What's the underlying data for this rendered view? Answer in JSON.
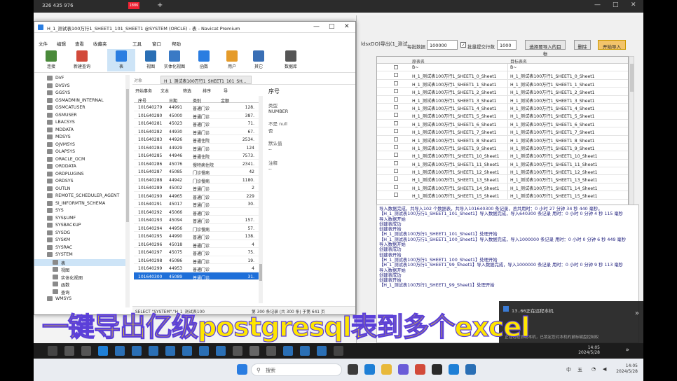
{
  "outer_bar": {
    "ip": "326 435 976",
    "tab": "1886",
    "plus": "+",
    "controls": [
      "—",
      "□",
      "✕"
    ]
  },
  "datasync": {
    "title": "ldsxDO)导出(1_测试",
    "labels": {
      "batch": "每批数据",
      "batch_value": "100000",
      "commit_label": "批量提交行数",
      "commit_value": "1000",
      "check": "✓"
    },
    "buttons": {
      "select": "选择要导入的目标",
      "delete": "删除",
      "start": "开始导入"
    },
    "grid_headers": {
      "src": "原表名",
      "dst": "目标表名"
    },
    "grid_rows": [
      {
        "src": "B~",
        "dst": "B~"
      },
      {
        "src": "H_1_测试表100万行1_SHEET1_0_Sheet1",
        "dst": "H_1_测试表100万行1_SHEET1_0_Sheet1"
      },
      {
        "src": "H_1_测试表100万行1_SHEET1_1_Sheet1",
        "dst": "H_1_测试表100万行1_SHEET1_1_Sheet1"
      },
      {
        "src": "H_1_测试表100万行1_SHEET1_2_Sheet1",
        "dst": "H_1_测试表100万行1_SHEET1_2_Sheet1"
      },
      {
        "src": "H_1_测试表100万行1_SHEET1_3_Sheet1",
        "dst": "H_1_测试表100万行1_SHEET1_3_Sheet1"
      },
      {
        "src": "H_1_测试表100万行1_SHEET1_4_Sheet1",
        "dst": "H_1_测试表100万行1_SHEET1_4_Sheet1"
      },
      {
        "src": "H_1_测试表100万行1_SHEET1_5_Sheet1",
        "dst": "H_1_测试表100万行1_SHEET1_5_Sheet1"
      },
      {
        "src": "H_1_测试表100万行1_SHEET1_6_Sheet1",
        "dst": "H_1_测试表100万行1_SHEET1_6_Sheet1"
      },
      {
        "src": "H_1_测试表100万行1_SHEET1_7_Sheet1",
        "dst": "H_1_测试表100万行1_SHEET1_7_Sheet1"
      },
      {
        "src": "H_1_测试表100万行1_SHEET1_8_Sheet1",
        "dst": "H_1_测试表100万行1_SHEET1_8_Sheet1"
      },
      {
        "src": "H_1_测试表100万行1_SHEET1_9_Sheet1",
        "dst": "H_1_测试表100万行1_SHEET1_9_Sheet1"
      },
      {
        "src": "H_1_测试表100万行1_SHEET1_10_Sheet1",
        "dst": "H_1_测试表100万行1_SHEET1_10_Sheet1"
      },
      {
        "src": "H_1_测试表100万行1_SHEET1_11_Sheet1",
        "dst": "H_1_测试表100万行1_SHEET1_11_Sheet1"
      },
      {
        "src": "H_1_测试表100万行1_SHEET1_12_Sheet1",
        "dst": "H_1_测试表100万行1_SHEET1_12_Sheet1"
      },
      {
        "src": "H_1_测试表100万行1_SHEET1_13_Sheet1",
        "dst": "H_1_测试表100万行1_SHEET1_13_Sheet1"
      },
      {
        "src": "H_1_测试表100万行1_SHEET1_14_Sheet1",
        "dst": "H_1_测试表100万行1_SHEET1_14_Sheet1"
      },
      {
        "src": "H_1_测试表100万行1_SHEET1_15_Sheet1",
        "dst": "H_1_测试表100万行1_SHEET1_15_Sheet1"
      }
    ],
    "log_lines": [
      "导入数据完成，共导入102 个数据表，共导入101640300 条记录，总共用时：0 小时 27 分钟 34 秒 440 毫秒。",
      "【H_1_测试表100万行1_SHEET1_101_Sheet1】导入数据完成，导入640300 条记录 用时：0 小时 0 分钟 4 秒 115 毫秒",
      "  导入数据开始",
      "  创建表成功",
      "  创建表开始",
      "【H_1_测试表100万行1_SHEET1_101_Sheet1】处理开始",
      "【H_1_测试表100万行1_SHEET1_100_Sheet1】导入数据完成，导入1000000 条记录 用时：0 小时 0 分钟 6 秒 449 毫秒",
      "  导入数据开始",
      "  创建表成功",
      "  创建表开始",
      "【H_1_测试表100万行1_SHEET1_100_Sheet1】处理开始",
      "【H_1_测试表100万行1_SHEET1_99_Sheet1】导入数据完成，导入1000000 条记录 用时：0 小时 0 分钟 9 秒 113 毫秒",
      "  导入数据开始",
      "  创建表成功",
      "  创建表开始",
      "【H_1_测试表100万行1_SHEET1_99_Sheet1】处理开始"
    ]
  },
  "navicat": {
    "title": "H_1_测试表100万行1_SHEET1_101_SHEET1 @SYSTEM (ORCLE) - 表 - Navicat Premium",
    "menu": [
      "文件",
      "编辑",
      "查看",
      "收藏夹",
      "工具",
      "窗口",
      "帮助"
    ],
    "ribbon": [
      {
        "label": "连接",
        "color": "#4a8a3a"
      },
      {
        "label": "新建查询",
        "color": "#d24a3a"
      },
      {
        "label": "表",
        "color": "#2a7de1"
      },
      {
        "label": "视图",
        "color": "#2a6fb5"
      },
      {
        "label": "实体化视图",
        "color": "#3a7ac5"
      },
      {
        "label": "函数",
        "color": "#2a7de1"
      },
      {
        "label": "用户",
        "color": "#e59b2a"
      },
      {
        "label": "其它",
        "color": "#3a6fb5"
      },
      {
        "label": "数据库",
        "color": "#555"
      }
    ],
    "tree": [
      "DVF",
      "DVSYS",
      "GGSYS",
      "GSMADMIN_INTERNAL",
      "GSMCATUSER",
      "GSMUSER",
      "LBACSYS",
      "MDDATA",
      "MDSYS",
      "OJVMSYS",
      "OLAPSYS",
      "ORACLE_OCM",
      "ORDDATA",
      "ORDPLUGINS",
      "ORDSYS",
      "OUTLN",
      "REMOTE_SCHEDULER_AGENT",
      "SI_INFORMTN_SCHEMA",
      "SYS",
      "SYS$UMF",
      "SYSBACKUP",
      "SYSDG",
      "SYSKM",
      "SYSRAC",
      "SYSTEM",
      "表",
      "视图",
      "实体化视图",
      "函数",
      "查询",
      "WMSYS"
    ],
    "obj_tab": {
      "objects": "对象",
      "table": "H_1_测试表100万行1_SHEET1_101_SH..."
    },
    "tools": [
      "开始事务",
      "文本",
      "筛选",
      "排序",
      "导"
    ],
    "table_headers": [
      "序号",
      "日期",
      "类别",
      "金额"
    ],
    "rows": [
      [
        "101640279",
        "44991",
        "普通门诊",
        "128."
      ],
      [
        "101640280",
        "45000",
        "普通门诊",
        "387."
      ],
      [
        "101640281",
        "45023",
        "普通门诊",
        "71."
      ],
      [
        "101640282",
        "44930",
        "普通门诊",
        "67."
      ],
      [
        "101640283",
        "44926",
        "普通住院",
        "2534."
      ],
      [
        "101640284",
        "44929",
        "普通门诊",
        "124"
      ],
      [
        "101640285",
        "44946",
        "普通住院",
        "7573."
      ],
      [
        "101640286",
        "45076",
        "慢特病住院",
        "2341."
      ],
      [
        "101640287",
        "45085",
        "门诊慢病",
        "42"
      ],
      [
        "101640288",
        "44942",
        "门诊慢病",
        "1180."
      ],
      [
        "101640289",
        "45002",
        "普通门诊",
        "2"
      ],
      [
        "101640290",
        "44965",
        "普通门诊",
        "229"
      ],
      [
        "101640291",
        "45017",
        "普通门诊",
        "30."
      ],
      [
        "101640292",
        "45066",
        "普通门诊",
        ""
      ],
      [
        "101640293",
        "45094",
        "普通门诊",
        "157."
      ],
      [
        "101640294",
        "44956",
        "门诊慢病",
        "57."
      ],
      [
        "101640295",
        "44990",
        "普通门诊",
        "138."
      ],
      [
        "101640296",
        "45018",
        "普通门诊",
        "4"
      ],
      [
        "101640297",
        "45075",
        "普通门诊",
        "75."
      ],
      [
        "101640298",
        "45086",
        "普通门诊",
        "19."
      ],
      [
        "101640299",
        "44953",
        "普通门诊",
        "4"
      ],
      [
        "101640300",
        "45089",
        "普通门诊",
        "31."
      ]
    ],
    "props": {
      "name": "序号",
      "type_label": "类型",
      "type": "NUMBER",
      "null_label": "不是 null",
      "null_value": "否",
      "default_label": "默认值",
      "default_value": "--",
      "comment_label": "注释",
      "comment_value": "--"
    },
    "status": {
      "sql": "SELECT \"SYSTEM\".\"H_1_测试表100",
      "records": "第 300 条记录 (共 300 条) 于第 641 页"
    }
  },
  "banner": "一键导出亿级postgresql表到多个excel",
  "notif": {
    "text": "13..66正在远程本机",
    "sub": "正在远程协助本机，已锁定您对本机的鼠标键盘控制权"
  },
  "inner_clock": {
    "time": "14:05",
    "date": "2024/5/28"
  },
  "taskbar": {
    "search": "搜索",
    "ime": "中",
    "ime2": "五",
    "time": "14:05",
    "date": "2024/5/28"
  }
}
